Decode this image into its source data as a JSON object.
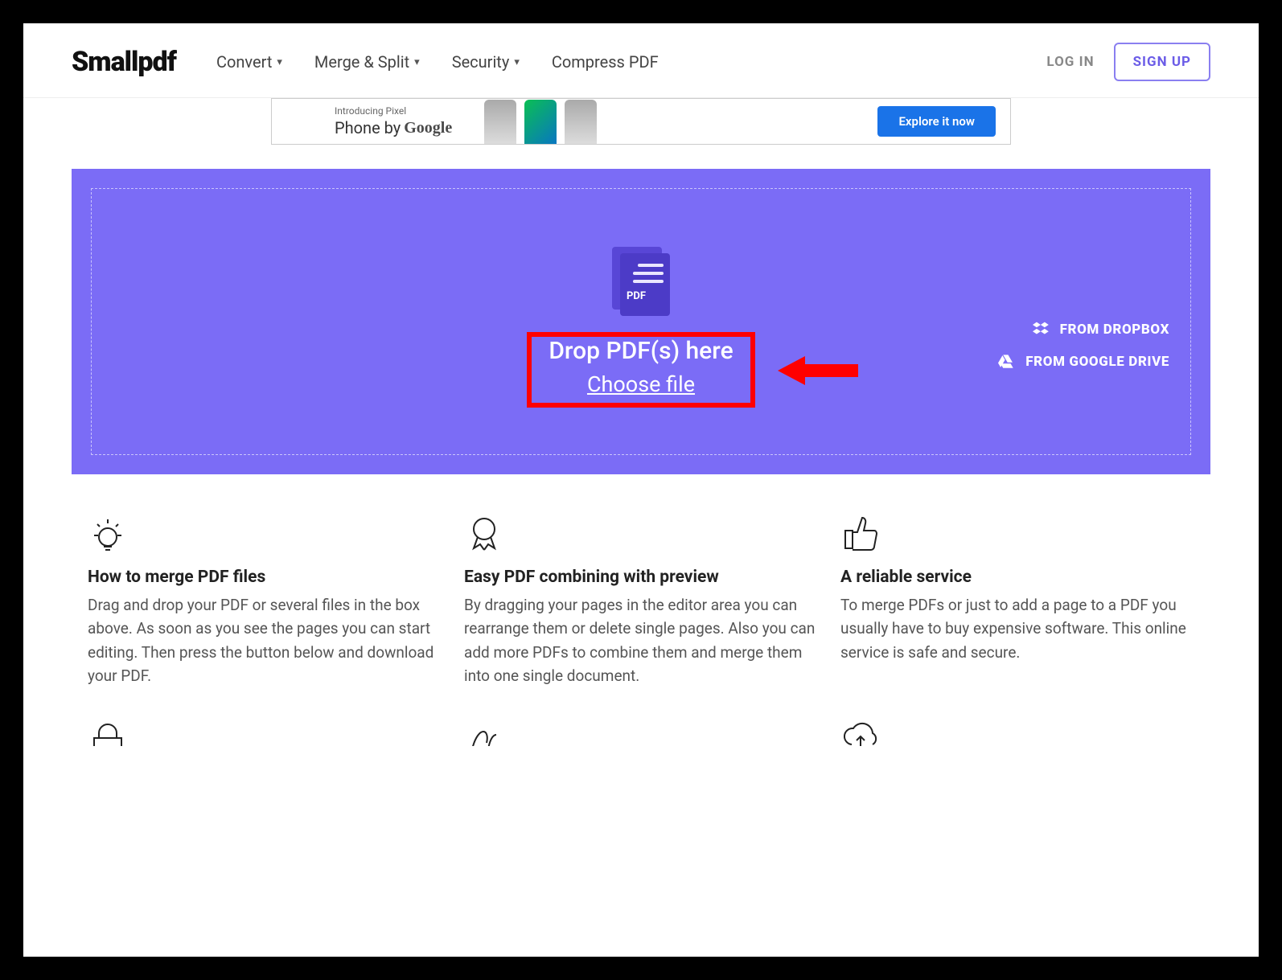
{
  "brand": "Smallpdf",
  "nav": {
    "convert": "Convert",
    "merge_split": "Merge & Split",
    "security": "Security",
    "compress": "Compress PDF"
  },
  "auth": {
    "login": "LOG IN",
    "signup": "SIGN UP"
  },
  "ad": {
    "intro": "Introducing Pixel",
    "line1": "Phone by",
    "google": "Google",
    "cta": "Explore it now"
  },
  "dropzone": {
    "pdf_badge": "PDF",
    "title": "Drop PDF(s) here",
    "choose": "Choose file",
    "from_dropbox": "FROM DROPBOX",
    "from_gdrive": "FROM GOOGLE DRIVE"
  },
  "features": [
    {
      "title": "How to merge PDF files",
      "text": "Drag and drop your PDF or several files in the box above. As soon as you see the pages you can start editing. Then press the button below and download your PDF."
    },
    {
      "title": "Easy PDF combining with preview",
      "text": "By dragging your pages in the editor area you can rearrange them or delete single pages. Also you can add more PDFs to combine them and merge them into one single document."
    },
    {
      "title": "A reliable service",
      "text": "To merge PDFs or just to add a page to a PDF you usually have to buy expensive software. This online service is safe and secure."
    }
  ]
}
